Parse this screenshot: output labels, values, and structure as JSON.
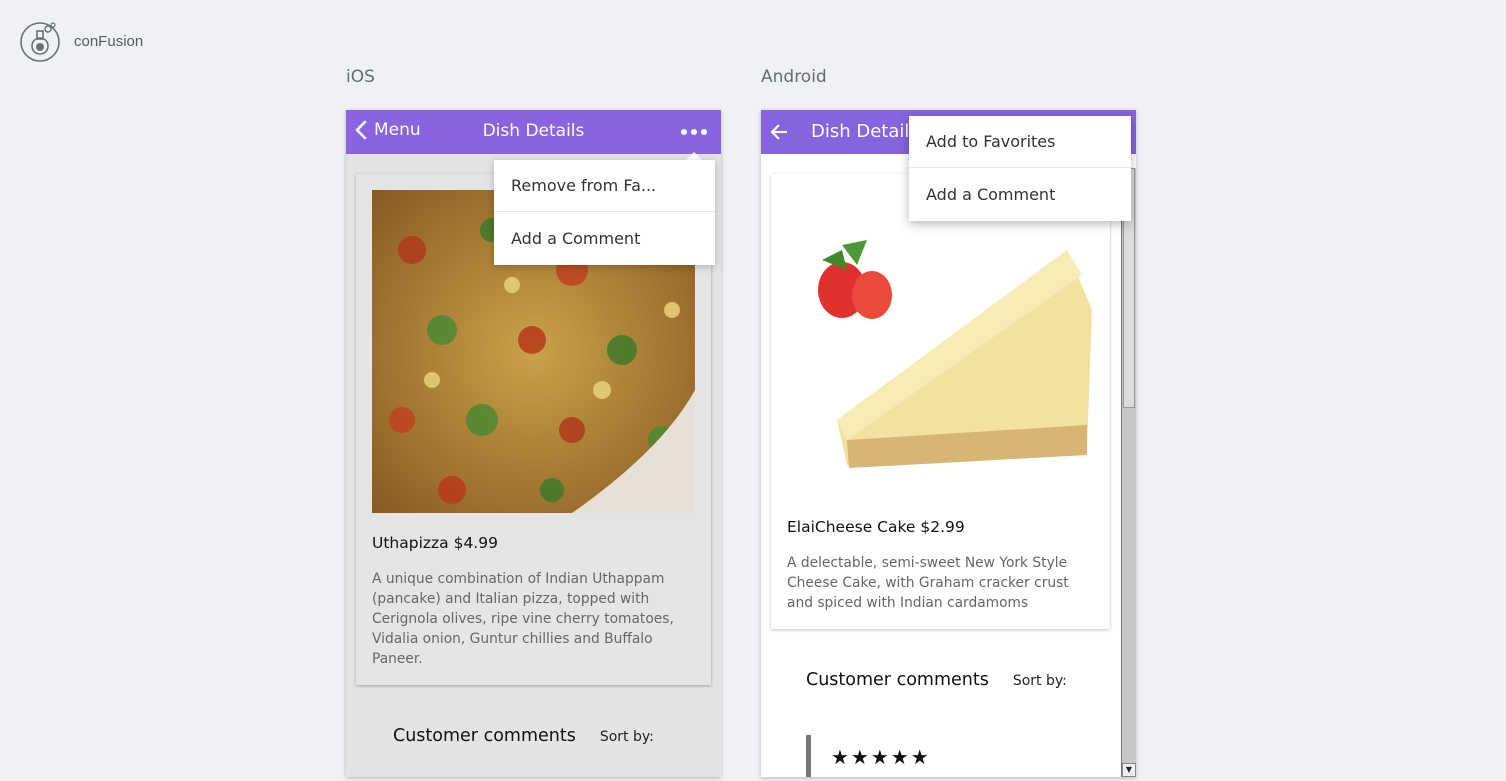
{
  "app": {
    "brand": "conFusion"
  },
  "labels": {
    "ios": "iOS",
    "android": "Android"
  },
  "ios": {
    "back_label": "Menu",
    "title": "Dish Details",
    "popover": [
      "Remove from Fa...",
      "Add a Comment"
    ],
    "dish": {
      "title": "Uthapizza $4.99",
      "description": "A unique combination of Indian Uthappam (pancake) and Italian pizza, topped with Cerignola olives, ripe vine cherry tomatoes, Vidalia onion, Guntur chillies and Buffalo Paneer."
    },
    "comments_title": "Customer comments",
    "sort_label": "Sort by:"
  },
  "android": {
    "title": "Dish Details",
    "popover": [
      "Add to Favorites",
      "Add a Comment"
    ],
    "dish": {
      "title": "ElaiCheese Cake $2.99",
      "description": "A delectable, semi-sweet New York Style Cheese Cake, with Graham cracker crust and spiced with Indian cardamoms"
    },
    "comments_title": "Customer comments",
    "sort_label": "Sort by:",
    "rating": "★★★★★"
  },
  "colors": {
    "accent": "#8a63e0",
    "background": "#f0f1f5"
  }
}
